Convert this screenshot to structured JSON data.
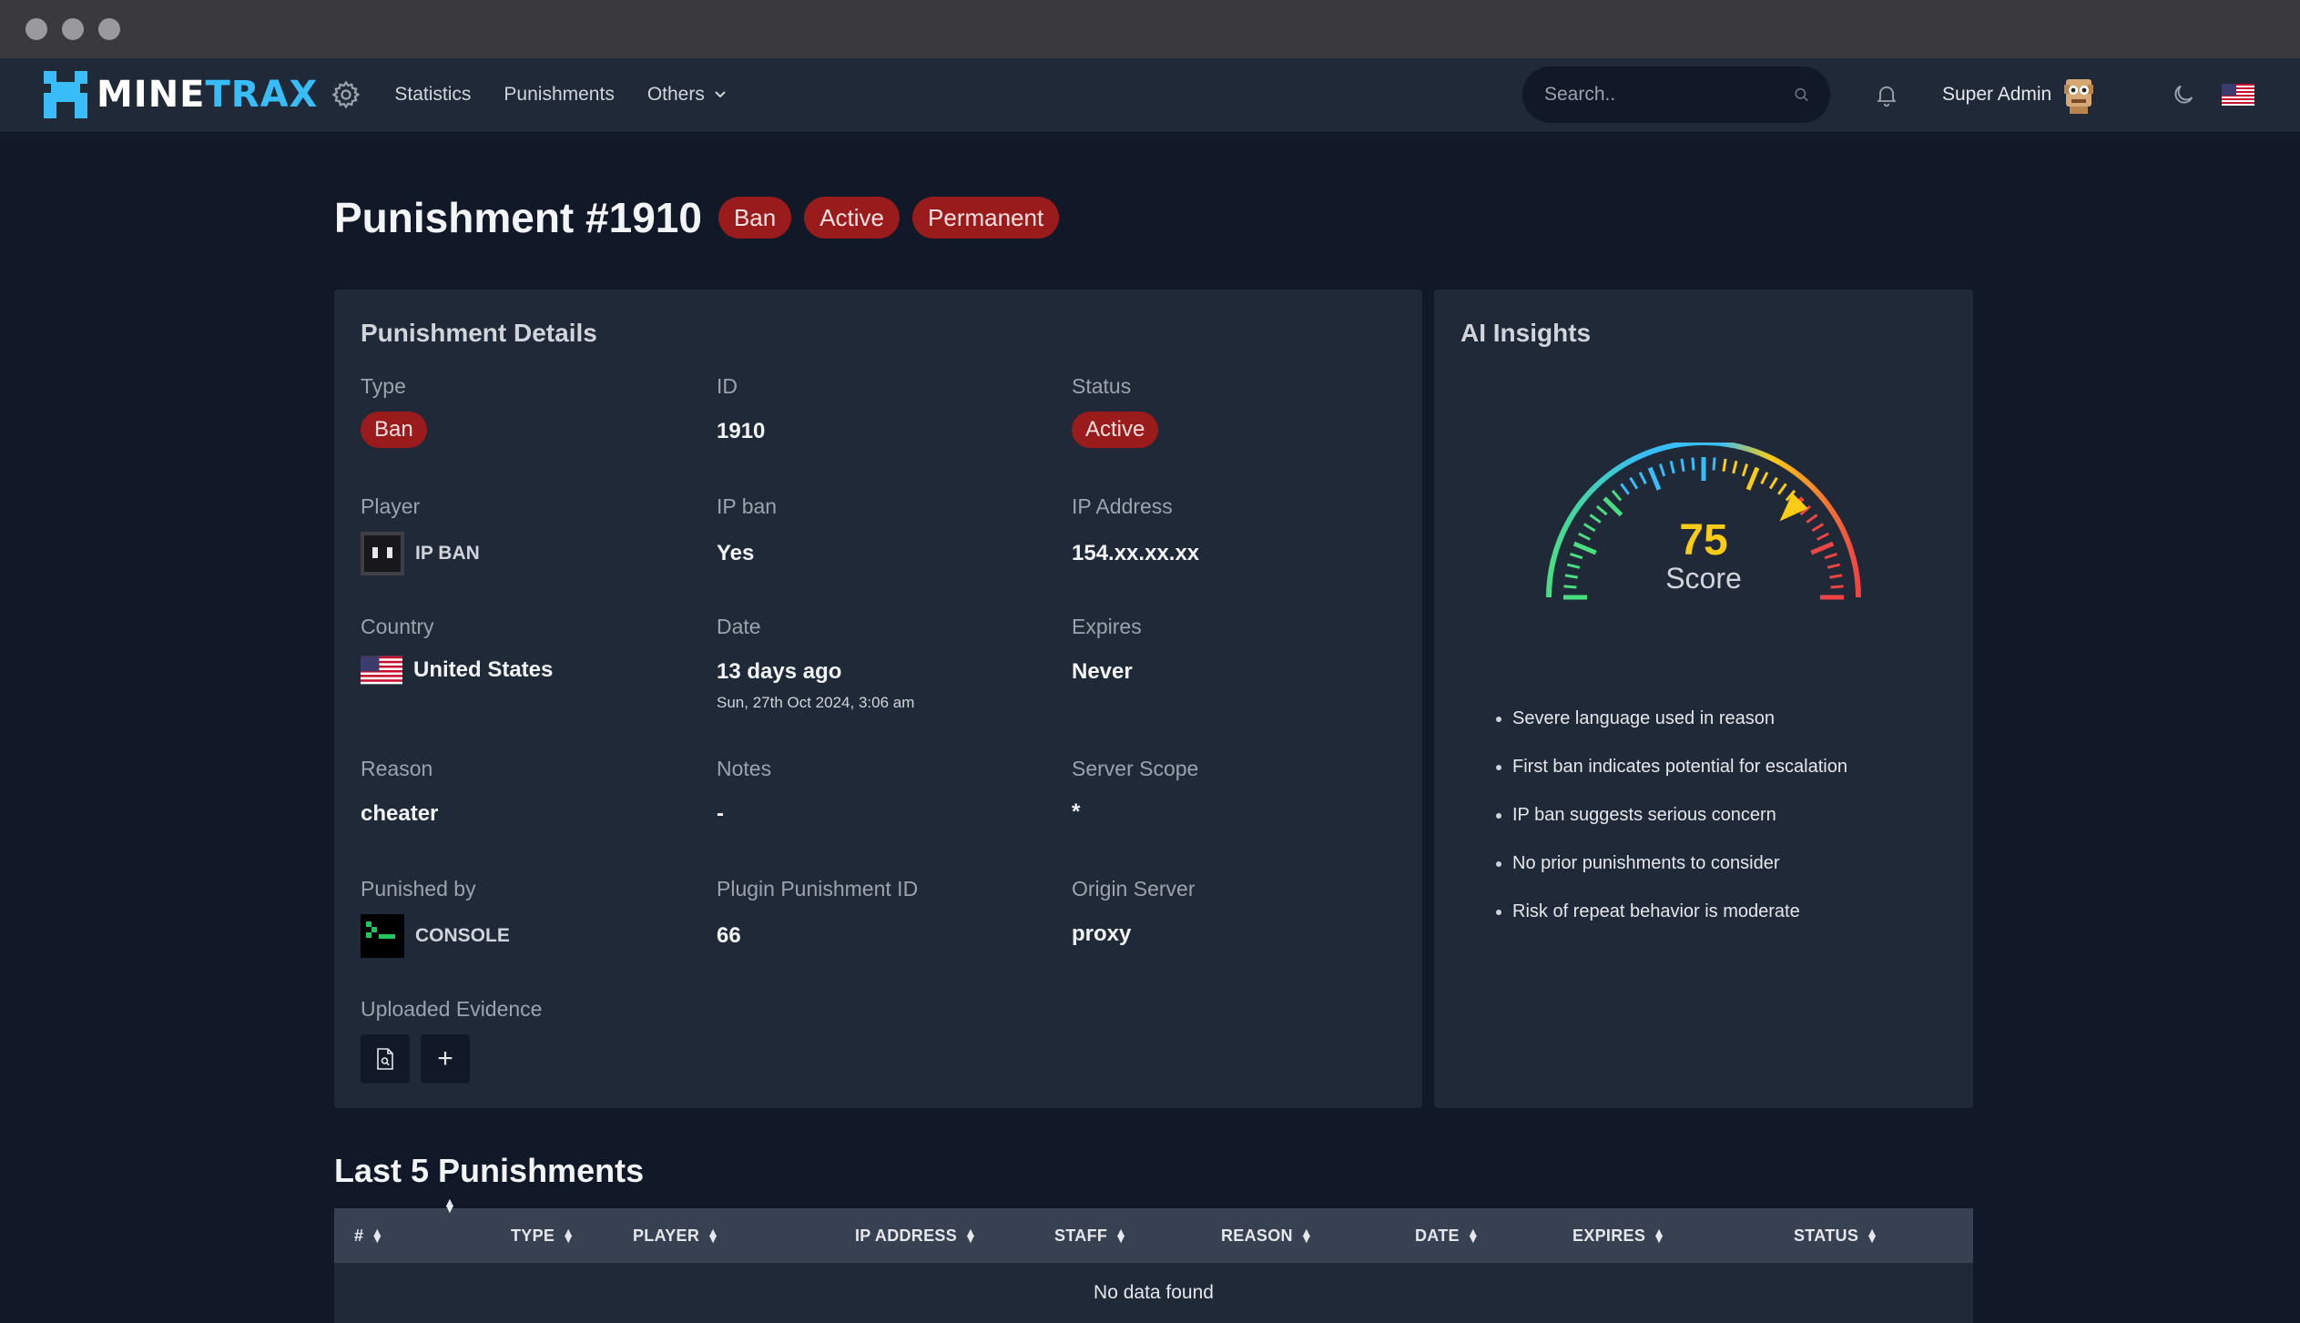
{
  "nav": {
    "brand_part1": "MINE",
    "brand_part2": "TRAX",
    "links": [
      "Statistics",
      "Punishments",
      "Others"
    ],
    "search_placeholder": "Search..",
    "user_name": "Super Admin"
  },
  "page": {
    "title": "Punishment #1910",
    "badges": [
      "Ban",
      "Active",
      "Permanent"
    ]
  },
  "details": {
    "title": "Punishment Details",
    "type_label": "Type",
    "type_value": "Ban",
    "id_label": "ID",
    "id_value": "1910",
    "status_label": "Status",
    "status_value": "Active",
    "player_label": "Player",
    "player_value": "IP BAN",
    "ipban_label": "IP ban",
    "ipban_value": "Yes",
    "ip_label": "IP Address",
    "ip_value": "154.xx.xx.xx",
    "country_label": "Country",
    "country_value": "United States",
    "date_label": "Date",
    "date_value": "13 days ago",
    "date_full": "Sun, 27th Oct 2024, 3:06 am",
    "expires_label": "Expires",
    "expires_value": "Never",
    "reason_label": "Reason",
    "reason_value": "cheater",
    "notes_label": "Notes",
    "notes_value": "-",
    "scope_label": "Server Scope",
    "scope_value": "*",
    "punisher_label": "Punished by",
    "punisher_value": "CONSOLE",
    "plugin_id_label": "Plugin Punishment ID",
    "plugin_id_value": "66",
    "origin_label": "Origin Server",
    "origin_value": "proxy",
    "evidence_label": "Uploaded Evidence",
    "add_label": "+"
  },
  "insights": {
    "title": "AI Insights",
    "score": 75,
    "score_text": "75",
    "score_label": "Score",
    "items": [
      "Severe language used in reason",
      "First ban indicates potential for escalation",
      "IP ban suggests serious concern",
      "No prior punishments to consider",
      "Risk of repeat behavior is moderate"
    ]
  },
  "last": {
    "title": "Last 5 Punishments",
    "columns": [
      "#",
      "",
      "TYPE",
      "PLAYER",
      "IP ADDRESS",
      "STAFF",
      "REASON",
      "DATE",
      "EXPIRES",
      "STATUS"
    ],
    "empty_text": "No data found"
  },
  "colors": {
    "page_bg": "#111827",
    "card_bg": "#1f2937",
    "badge_red": "#991b1b",
    "accent_blue": "#38bdf8",
    "gauge_score": "#facc15"
  },
  "icons": {
    "settings": "gear-icon",
    "dropdown": "chevron-down-icon",
    "search": "search-icon",
    "notifications": "bell-icon",
    "theme": "moon-icon",
    "language": "us-flag-icon",
    "evidence": "file-search-icon",
    "add": "plus-icon"
  }
}
